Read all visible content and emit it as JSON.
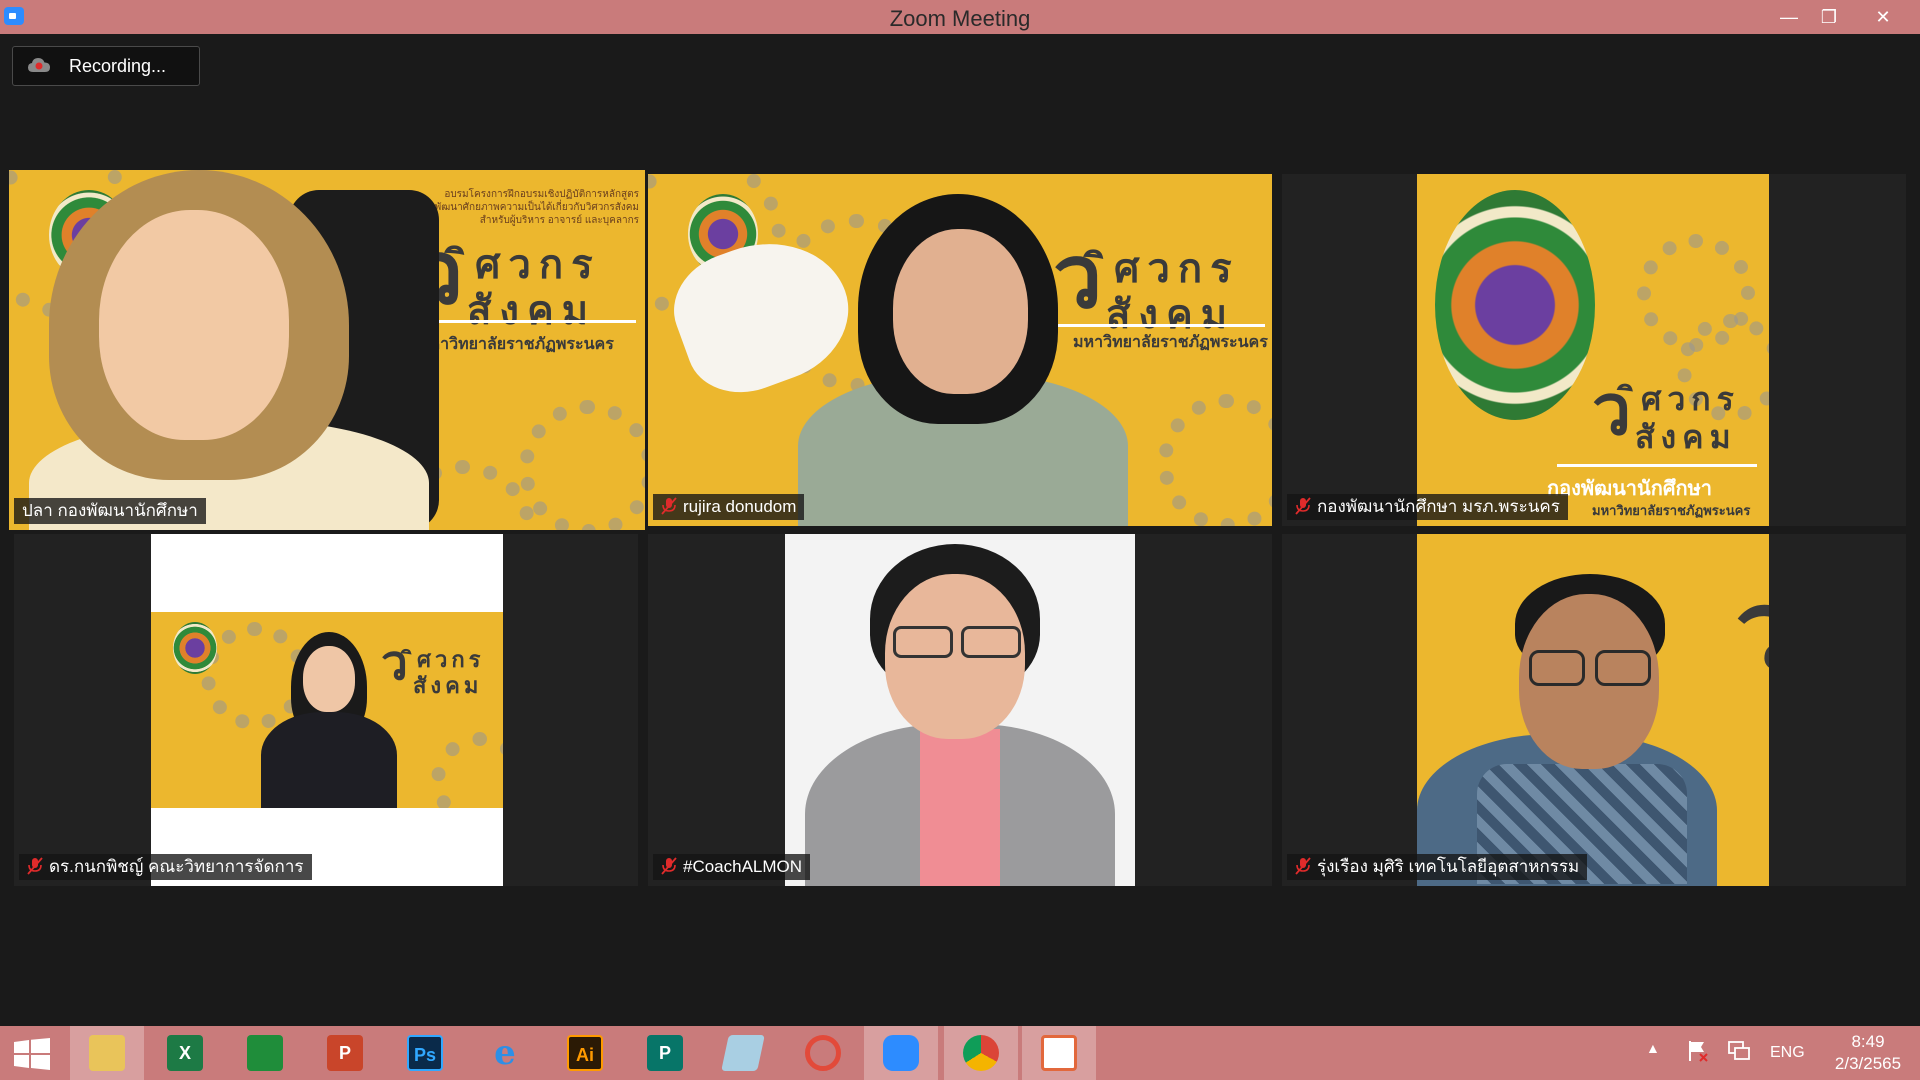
{
  "window": {
    "title": "Zoom Meeting",
    "minimize": "—",
    "maximize": "❐",
    "close": "✕"
  },
  "recording": {
    "label": "Recording..."
  },
  "tiles": [
    {
      "name": "ปลา กองพัฒนานักศึกษา",
      "muted": false,
      "speaking": true
    },
    {
      "name": "rujira donudom",
      "muted": true,
      "speaking": false
    },
    {
      "name": "กองพัฒนานักศึกษา มรภ.พระนคร",
      "muted": true,
      "speaking": false
    },
    {
      "name": "ดร.กนกพิชญ์ คณะวิทยาการจัดการ",
      "muted": true,
      "speaking": false
    },
    {
      "name": "#CoachALMON",
      "muted": true,
      "speaking": false
    },
    {
      "name": "รุ่งเรือง มุศิริ เทคโนโลยีอุตสาหกรรม",
      "muted": true,
      "speaking": false
    }
  ],
  "banner": {
    "headline": "อบรมโครงการฝึกอบรมเชิงปฏิบัติการหลักสูตร",
    "headline2": "การพัฒนาศักยภาพความเป็นได้เกี่ยวกับวิศวกรสังคม",
    "headline3": "สำหรับผู้บริหาร อาจารย์ และบุคลากร",
    "word1": "ิศวกร",
    "word2": "สังคม",
    "university": "มหาวิทยาลัยราชภัฏพระนคร",
    "division": "กองพัฒนานักศึกษา"
  },
  "colors": {
    "banner": "#ecb72e",
    "titlebar": "#c97b7b",
    "active_border": "#b6ec4a",
    "muted_icon": "#e02b2b"
  },
  "taskbar": {
    "items": [
      {
        "icon": "windows-start-icon",
        "label": ""
      },
      {
        "icon": "file-explorer-icon",
        "label": ""
      },
      {
        "icon": "excel-icon",
        "label": "X"
      },
      {
        "icon": "store-icon",
        "label": ""
      },
      {
        "icon": "powerpoint-icon",
        "label": "P"
      },
      {
        "icon": "photoshop-icon",
        "label": "Ps"
      },
      {
        "icon": "internet-explorer-icon",
        "label": "e"
      },
      {
        "icon": "illustrator-icon",
        "label": "Ai"
      },
      {
        "icon": "publisher-icon",
        "label": "P"
      },
      {
        "icon": "notes-icon",
        "label": ""
      },
      {
        "icon": "photoscape-icon",
        "label": ""
      },
      {
        "icon": "zoom-icon",
        "label": ""
      },
      {
        "icon": "chrome-icon",
        "label": ""
      },
      {
        "icon": "slides-app-icon",
        "label": ""
      }
    ],
    "tray": {
      "lang": "ENG",
      "time": "8:49",
      "date": "2/3/2565"
    }
  }
}
